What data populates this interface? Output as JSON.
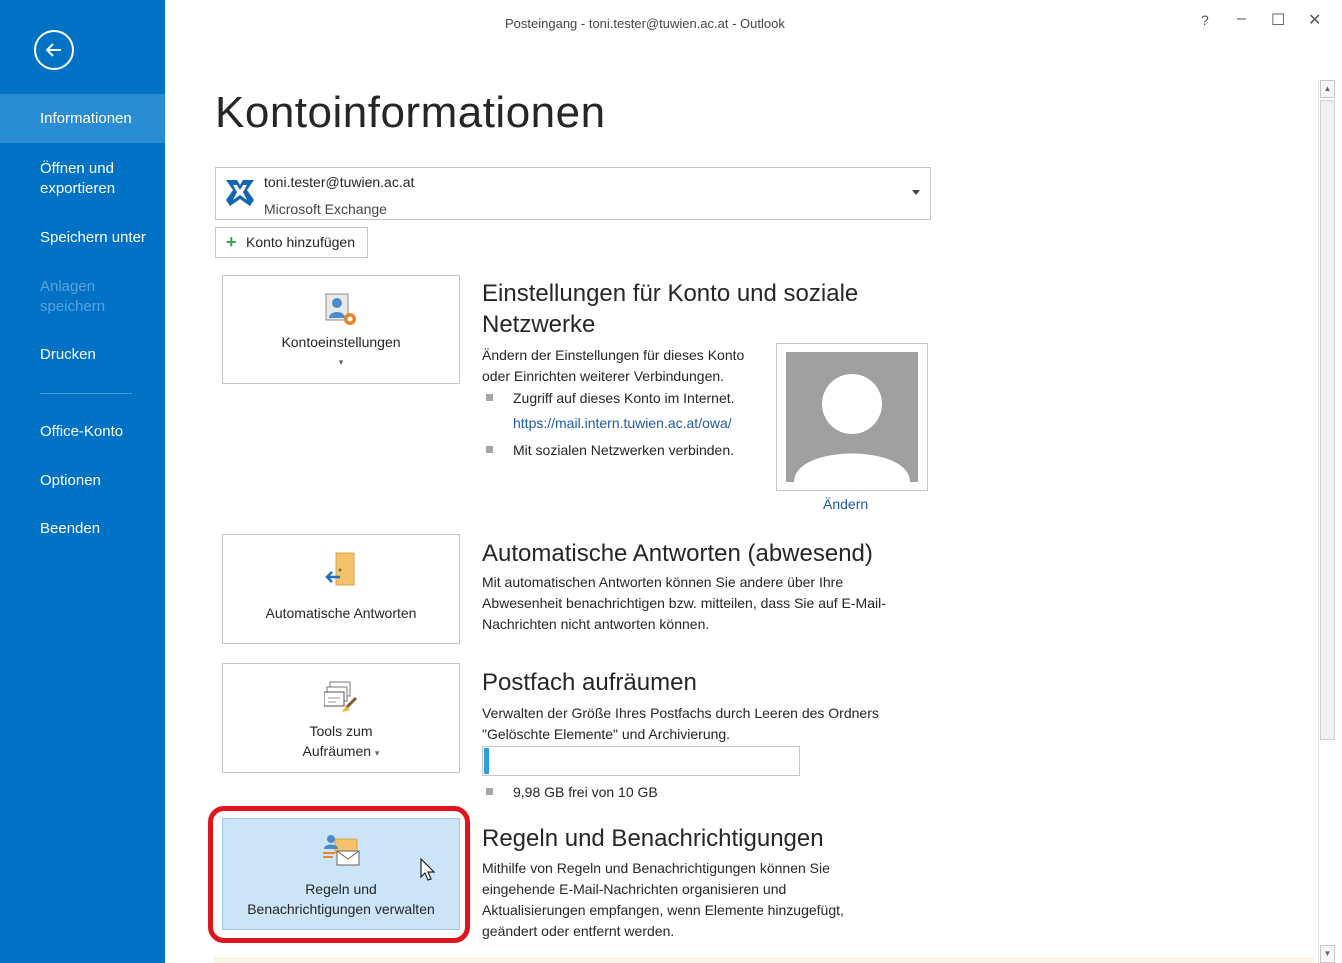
{
  "window": {
    "title": "Posteingang - toni.tester@tuwien.ac.at - Outlook",
    "help": "?",
    "minimize": "–",
    "maximize": "☐",
    "close": "✕"
  },
  "sidebar": {
    "items": [
      {
        "label": "Informationen",
        "state": "active"
      },
      {
        "label": "Öffnen und exportieren",
        "line1": "Öffnen und",
        "line2": "exportieren"
      },
      {
        "label": "Speichern unter"
      },
      {
        "label": "Anlagen speichern",
        "line1": "Anlagen",
        "line2": "speichern",
        "state": "disabled"
      },
      {
        "label": "Drucken"
      },
      {
        "label": "Office-Konto"
      },
      {
        "label": "Optionen"
      },
      {
        "label": "Beenden"
      }
    ]
  },
  "main": {
    "title": "Kontoinformationen",
    "account": {
      "email": "toni.tester@tuwien.ac.at",
      "type": "Microsoft Exchange"
    },
    "add_account_label": "Konto hinzufügen",
    "sections": {
      "settings": {
        "tile_label": "Kontoeinstellungen",
        "title_line1": "Einstellungen für Konto und soziale",
        "title_line2": "Netzwerke",
        "desc_line1": "Ändern der Einstellungen für dieses Konto",
        "desc_line2": "oder Einrichten weiterer Verbindungen.",
        "bullet1": "Zugriff auf dieses Konto im Internet.",
        "bullet1_link": "https://mail.intern.tuwien.ac.at/owa/",
        "bullet2": "Mit sozialen Netzwerken verbinden.",
        "change_photo": "Ändern"
      },
      "auto_reply": {
        "tile_label": "Automatische Antworten",
        "title": "Automatische Antworten (abwesend)",
        "desc_line1": "Mit automatischen Antworten können Sie andere über Ihre",
        "desc_line2": "Abwesenheit benachrichtigen bzw. mitteilen, dass Sie auf E-Mail-",
        "desc_line3": "Nachrichten nicht antworten können."
      },
      "cleanup": {
        "tile_line1": "Tools zum",
        "tile_line2": "Aufräumen",
        "title": "Postfach aufräumen",
        "desc_line1": "Verwalten der Größe Ihres Postfachs durch Leeren des Ordners",
        "desc_line2": "\"Gelöschte Elemente\" und Archivierung.",
        "storage_text": "9,98 GB frei von 10 GB",
        "storage_used_fraction": 0.002
      },
      "rules": {
        "tile_line1": "Regeln und",
        "tile_line2": "Benachrichtigungen verwalten",
        "title": "Regeln und Benachrichtigungen",
        "desc_line1": "Mithilfe von Regeln und Benachrichtigungen können Sie",
        "desc_line2": "eingehende E-Mail-Nachrichten organisieren und",
        "desc_line3": "Aktualisierungen empfangen, wenn Elemente hinzugefügt,",
        "desc_line4": "geändert oder entfernt werden."
      }
    }
  },
  "colors": {
    "sidebar": "#0072c6",
    "sidebar_active": "#2a8dd4",
    "highlight_tile": "#cce4f7",
    "annotation_ring": "#e0141c",
    "link": "#1e5aa8"
  }
}
